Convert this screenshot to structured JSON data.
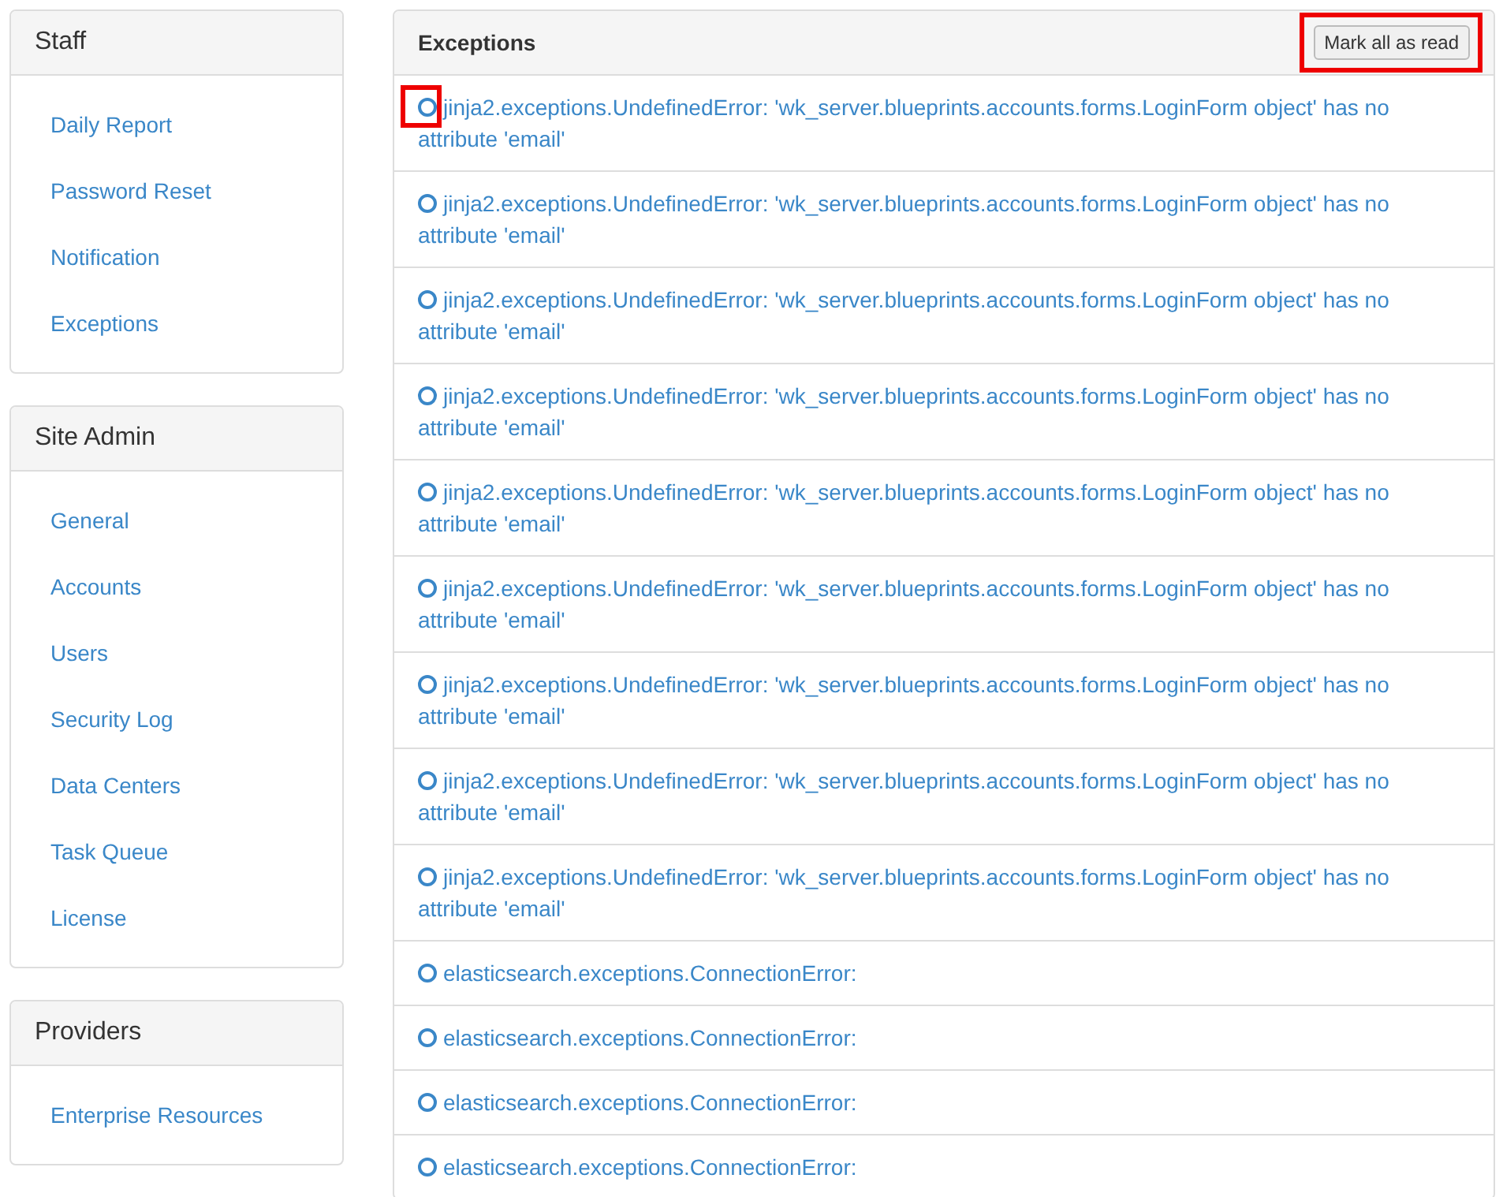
{
  "sidebar": [
    {
      "title": "Staff",
      "items": [
        "Daily Report",
        "Password Reset",
        "Notification",
        "Exceptions"
      ]
    },
    {
      "title": "Site Admin",
      "items": [
        "General",
        "Accounts",
        "Users",
        "Security Log",
        "Data Centers",
        "Task Queue",
        "License"
      ]
    },
    {
      "title": "Providers",
      "items": [
        "Enterprise Resources"
      ]
    }
  ],
  "exceptions": {
    "title": "Exceptions",
    "button": {
      "label": "Mark all as read",
      "highlighted": true
    },
    "items": [
      {
        "text": "jinja2.exceptions.UndefinedError: 'wk_server.blueprints.accounts.forms.LoginForm object' has no attribute 'email'",
        "highlighted": true
      },
      {
        "text": "jinja2.exceptions.UndefinedError: 'wk_server.blueprints.accounts.forms.LoginForm object' has no attribute 'email'",
        "highlighted": false
      },
      {
        "text": "jinja2.exceptions.UndefinedError: 'wk_server.blueprints.accounts.forms.LoginForm object' has no attribute 'email'",
        "highlighted": false
      },
      {
        "text": "jinja2.exceptions.UndefinedError: 'wk_server.blueprints.accounts.forms.LoginForm object' has no attribute 'email'",
        "highlighted": false
      },
      {
        "text": "jinja2.exceptions.UndefinedError: 'wk_server.blueprints.accounts.forms.LoginForm object' has no attribute 'email'",
        "highlighted": false
      },
      {
        "text": "jinja2.exceptions.UndefinedError: 'wk_server.blueprints.accounts.forms.LoginForm object' has no attribute 'email'",
        "highlighted": false
      },
      {
        "text": "jinja2.exceptions.UndefinedError: 'wk_server.blueprints.accounts.forms.LoginForm object' has no attribute 'email'",
        "highlighted": false
      },
      {
        "text": "jinja2.exceptions.UndefinedError: 'wk_server.blueprints.accounts.forms.LoginForm object' has no attribute 'email'",
        "highlighted": false
      },
      {
        "text": "jinja2.exceptions.UndefinedError: 'wk_server.blueprints.accounts.forms.LoginForm object' has no attribute 'email'",
        "highlighted": false
      },
      {
        "text": "elasticsearch.exceptions.ConnectionError:",
        "highlighted": false
      },
      {
        "text": "elasticsearch.exceptions.ConnectionError:",
        "highlighted": false
      },
      {
        "text": "elasticsearch.exceptions.ConnectionError:",
        "highlighted": false
      },
      {
        "text": "elasticsearch.exceptions.ConnectionError:",
        "highlighted": false
      }
    ]
  }
}
